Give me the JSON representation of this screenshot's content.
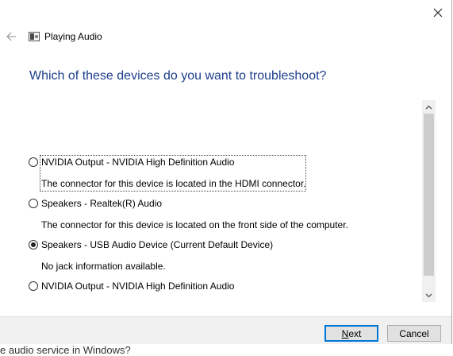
{
  "window": {
    "title": "Playing Audio",
    "question": "Which of these devices do you want to troubleshoot?"
  },
  "devices": [
    {
      "label": "NVIDIA Output - NVIDIA High Definition Audio",
      "description": "The connector for this device is located in the HDMI connector.",
      "checked": false
    },
    {
      "label": "Speakers - Realtek(R) Audio",
      "description": "The connector for this device is located on the front side of the computer.",
      "checked": false
    },
    {
      "label": "Speakers - USB Audio Device (Current Default Device)",
      "description": "No jack information available.",
      "checked": true
    },
    {
      "label": "NVIDIA Output - NVIDIA High Definition Audio",
      "description": "",
      "checked": false
    }
  ],
  "footer": {
    "next_label_prefix": "N",
    "next_label_rest": "ext",
    "cancel_label": "Cancel"
  },
  "background": {
    "partial_text": "e audio service in Windows?"
  },
  "icons": {
    "close": "close-icon",
    "back": "back-arrow-icon",
    "app": "audio-troubleshooter-icon",
    "scroll_up": "chevron-up-icon",
    "scroll_down": "chevron-down-icon"
  },
  "colors": {
    "question": "#1e3f8c",
    "primary_button_border": "#0078d7"
  }
}
